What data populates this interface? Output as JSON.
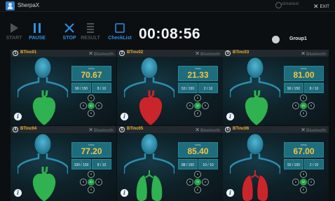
{
  "window": {
    "app_name": "SherpaX",
    "brand": "simanext",
    "exit_label": "EXIT"
  },
  "toolbar": {
    "start": "START",
    "pause": "PAUSE",
    "stop": "STOP",
    "result": "RESULT",
    "checklist": "CheckList",
    "timer": "00:08:56",
    "group": "Group1",
    "accent": "#2f8fe0"
  },
  "bluetooth_label": "Bluetooth",
  "score_label": "TOTAL",
  "panels": [
    {
      "index": "1",
      "name": "BTinc01",
      "score": "70.67",
      "left": "90 / 150",
      "right": "8 / 10",
      "organ": "heart",
      "organ_color": "#2fb24f",
      "c_top": "0",
      "c_left": "9",
      "c_mid": "81",
      "c_right": "0",
      "c_bot": "0",
      "mid_green": true
    },
    {
      "index": "2",
      "name": "BTinc02",
      "score": "21.33",
      "left": "53 / 150",
      "right": "2 / 10",
      "organ": "heart",
      "organ_color": "#c9262b",
      "c_top": "0",
      "c_left": "0",
      "c_mid": "32",
      "c_right": "0",
      "c_bot": "0",
      "mid_green": true
    },
    {
      "index": "3",
      "name": "BTinc03",
      "score": "81.00",
      "left": "90 / 150",
      "right": "8 / 10",
      "organ": "heart",
      "organ_color": "#2fb24f",
      "c_top": "0",
      "c_left": "9",
      "c_mid": "81",
      "c_right": "0",
      "c_bot": "0",
      "mid_green": true
    },
    {
      "index": "4",
      "name": "BTinc04",
      "score": "77.20",
      "left": "100 / 150",
      "right": "8 / 10",
      "organ": "heart",
      "organ_color": "#2fb24f",
      "c_top": "0",
      "c_left": "9",
      "c_mid": "81",
      "c_right": "0",
      "c_bot": "0",
      "mid_green": true
    },
    {
      "index": "5",
      "name": "BTinc05",
      "score": "85.40",
      "left": "88 / 150",
      "right": "10 / 10",
      "organ": "lungs",
      "organ_color": "#2fb24f",
      "c_top": "0",
      "c_left": "9",
      "c_mid": "79",
      "c_right": "0",
      "c_bot": "0",
      "mid_green": true
    },
    {
      "index": "6",
      "name": "BTinc06",
      "score": "67.00",
      "left": "92 / 150",
      "right": "2 / 10",
      "organ": "lungs",
      "organ_color": "#c9262b",
      "c_top": "0",
      "c_left": "0",
      "c_mid": "92",
      "c_right": "0",
      "c_bot": "0",
      "mid_green": true
    }
  ]
}
